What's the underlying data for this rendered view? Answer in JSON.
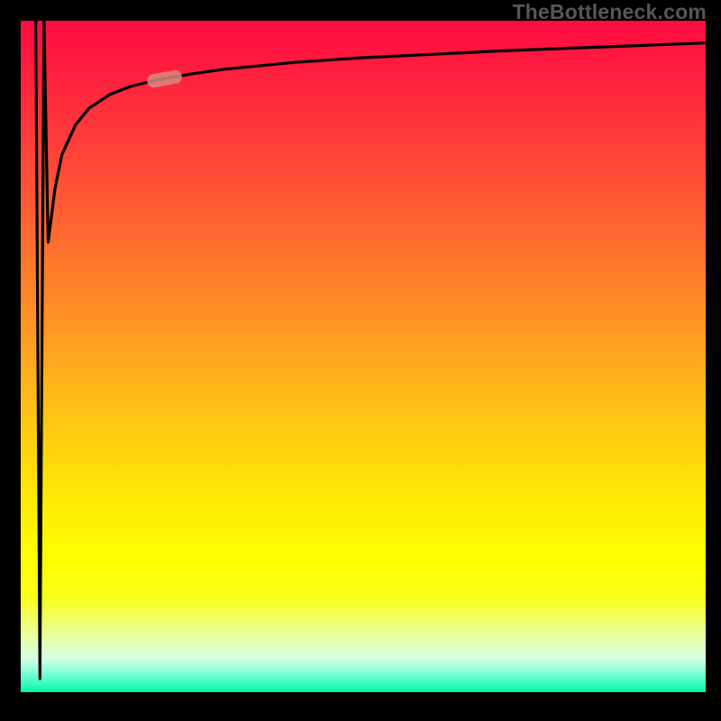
{
  "watermark": {
    "text": "TheBottleneck.com"
  },
  "colors": {
    "curve": "#000000",
    "marker": "#d68a7d",
    "background_top": "#ff0b42",
    "background_bottom": "#00f7a8"
  },
  "chart_data": {
    "type": "line",
    "title": "",
    "xlabel": "",
    "ylabel": "",
    "xlim": [
      0,
      100
    ],
    "ylim": [
      0,
      100
    ],
    "grid": false,
    "note": "Axes have no visible tick labels; x/y normalized 0-100. y values estimated from curve position against gradient background.",
    "series": [
      {
        "name": "spike",
        "x": [
          2.2,
          2.8,
          3.4
        ],
        "y": [
          100,
          2,
          100
        ]
      },
      {
        "name": "main-curve",
        "x": [
          3.4,
          4.0,
          5.0,
          6.0,
          8.0,
          10.0,
          13.0,
          16.0,
          20.0,
          25.0,
          30.0,
          40.0,
          50.0,
          60.0,
          70.0,
          80.0,
          90.0,
          100.0
        ],
        "y": [
          100,
          67,
          75,
          80,
          84.5,
          87,
          89,
          90.2,
          91.2,
          92.1,
          92.8,
          93.8,
          94.5,
          95.0,
          95.5,
          95.9,
          96.3,
          96.7
        ]
      }
    ],
    "annotations": [
      {
        "name": "marker",
        "x": 21.0,
        "y": 91.3
      }
    ]
  }
}
